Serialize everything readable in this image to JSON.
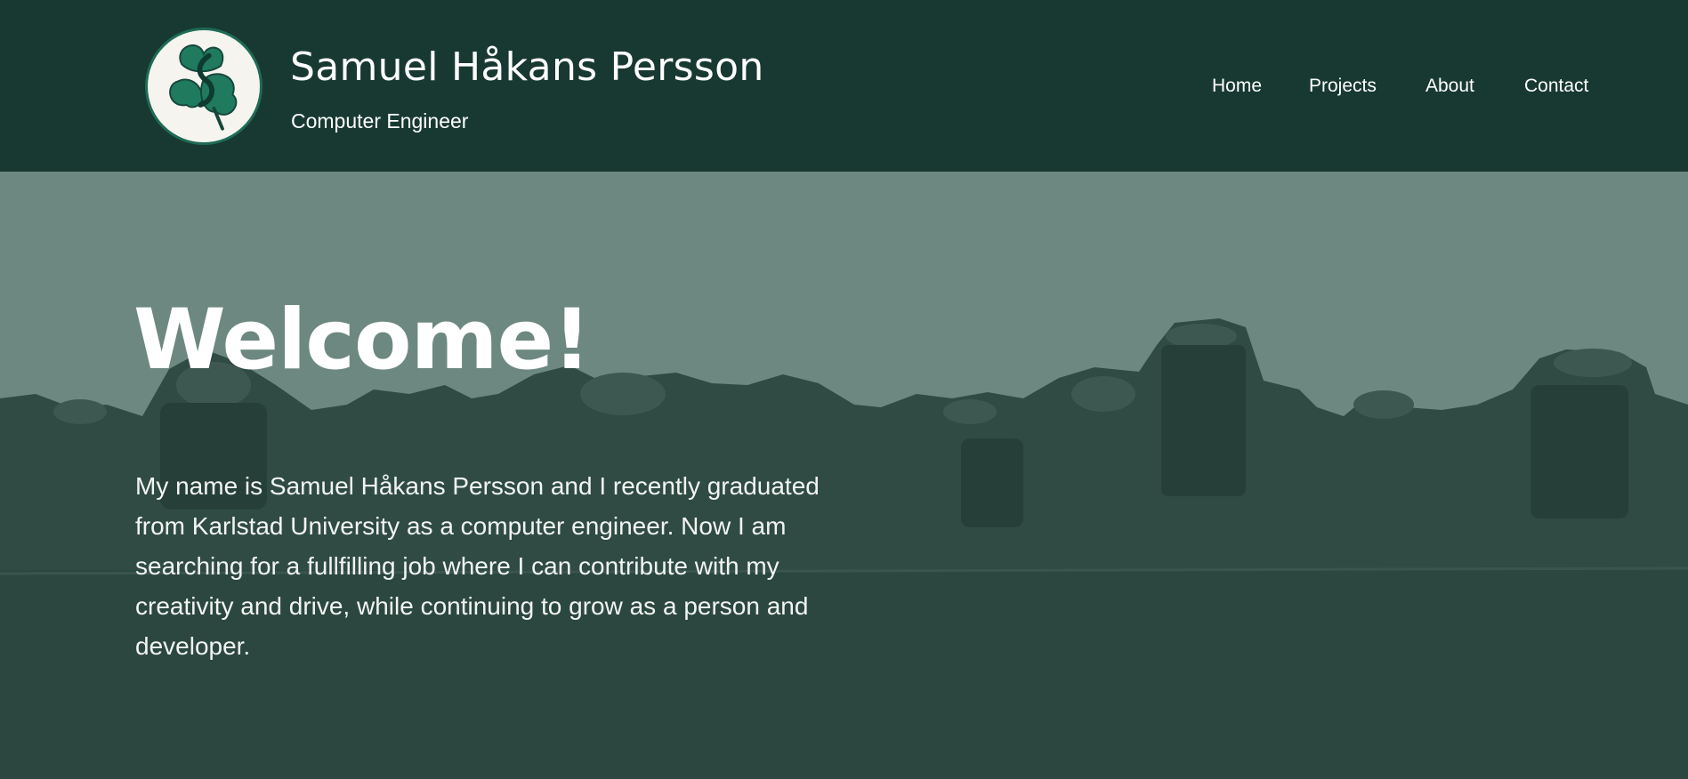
{
  "header": {
    "logo_icon": "shamrock-monogram-icon",
    "title": "Samuel Håkans Persson",
    "subtitle": "Computer Engineer"
  },
  "nav": {
    "items": [
      {
        "label": "Home"
      },
      {
        "label": "Projects"
      },
      {
        "label": "About"
      },
      {
        "label": "Contact"
      }
    ]
  },
  "hero": {
    "heading": "Welcome!",
    "intro": "My name is Samuel Håkans Persson and I recently graduated from Karlstad University as a computer engineer. Now I am searching for a fullfilling job where I can contribute with my creativity and drive, while continuing to grow as a person and developer.",
    "background_image": "concrete-tetrapods-breakwater"
  },
  "colors": {
    "header_bg": "#183931",
    "hero_sky": "#6d8880",
    "hero_blocks": "#2e4a43",
    "logo_green": "#1f6b55",
    "text": "#ffffff"
  }
}
